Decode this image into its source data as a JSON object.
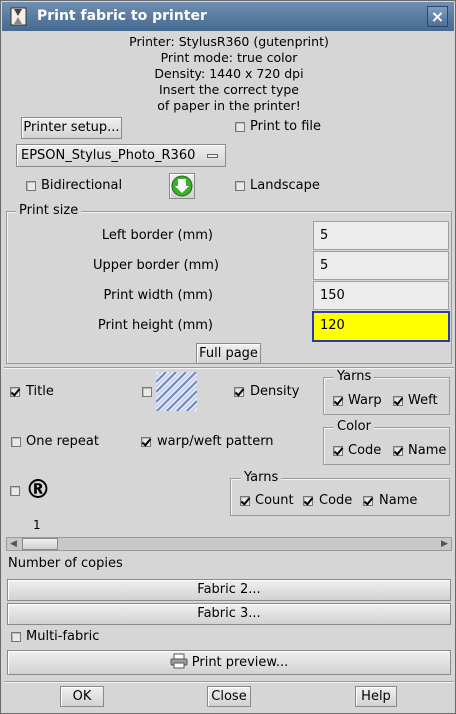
{
  "window": {
    "title": "Print fabric to printer",
    "close_label": "×"
  },
  "info": {
    "printer": "Printer: StylusR360 (gutenprint)",
    "mode": "Print mode: true color",
    "density": "Density: 1440 x 720 dpi",
    "note1": "Insert the correct type",
    "note2": "of paper in the printer!"
  },
  "printer_setup_label": "Printer setup...",
  "print_to_file": {
    "label": "Print to file",
    "checked": false
  },
  "printer_select": {
    "value": "EPSON_Stylus_Photo_R360"
  },
  "bidirectional": {
    "label": "Bidirectional",
    "checked": false
  },
  "landscape": {
    "label": "Landscape",
    "checked": false
  },
  "print_size": {
    "title": "Print size",
    "left_border": {
      "label": "Left border (mm)",
      "value": "5"
    },
    "upper_border": {
      "label": "Upper border (mm)",
      "value": "5"
    },
    "print_width": {
      "label": "Print width (mm)",
      "value": "150"
    },
    "print_height": {
      "label": "Print height (mm)",
      "value": "120"
    },
    "full_page_label": "Full page"
  },
  "options": {
    "title": {
      "label": "Title",
      "checked": true
    },
    "image_cb": {
      "checked": false
    },
    "density": {
      "label": "Density",
      "checked": true
    },
    "yarns1": {
      "title": "Yarns",
      "warp": "Warp",
      "weft": "Weft"
    },
    "one_repeat": {
      "label": "One repeat",
      "checked": false
    },
    "warp_weft": {
      "label": "warp/weft pattern",
      "checked": true
    },
    "color": {
      "title": "Color",
      "code": "Code",
      "name": "Name"
    },
    "registered": {
      "checked": false,
      "symbol": "®"
    },
    "yarns2": {
      "title": "Yarns",
      "count": "Count",
      "code": "Code",
      "name": "Name"
    }
  },
  "slider_value": "1",
  "copies_label": "Number of copies",
  "fabric2_label": "Fabric 2...",
  "fabric3_label": "Fabric 3...",
  "multi_fabric": {
    "label": "Multi-fabric",
    "checked": false
  },
  "print_preview_label": "Print preview...",
  "footer": {
    "ok": "OK",
    "close": "Close",
    "help": "Help"
  }
}
